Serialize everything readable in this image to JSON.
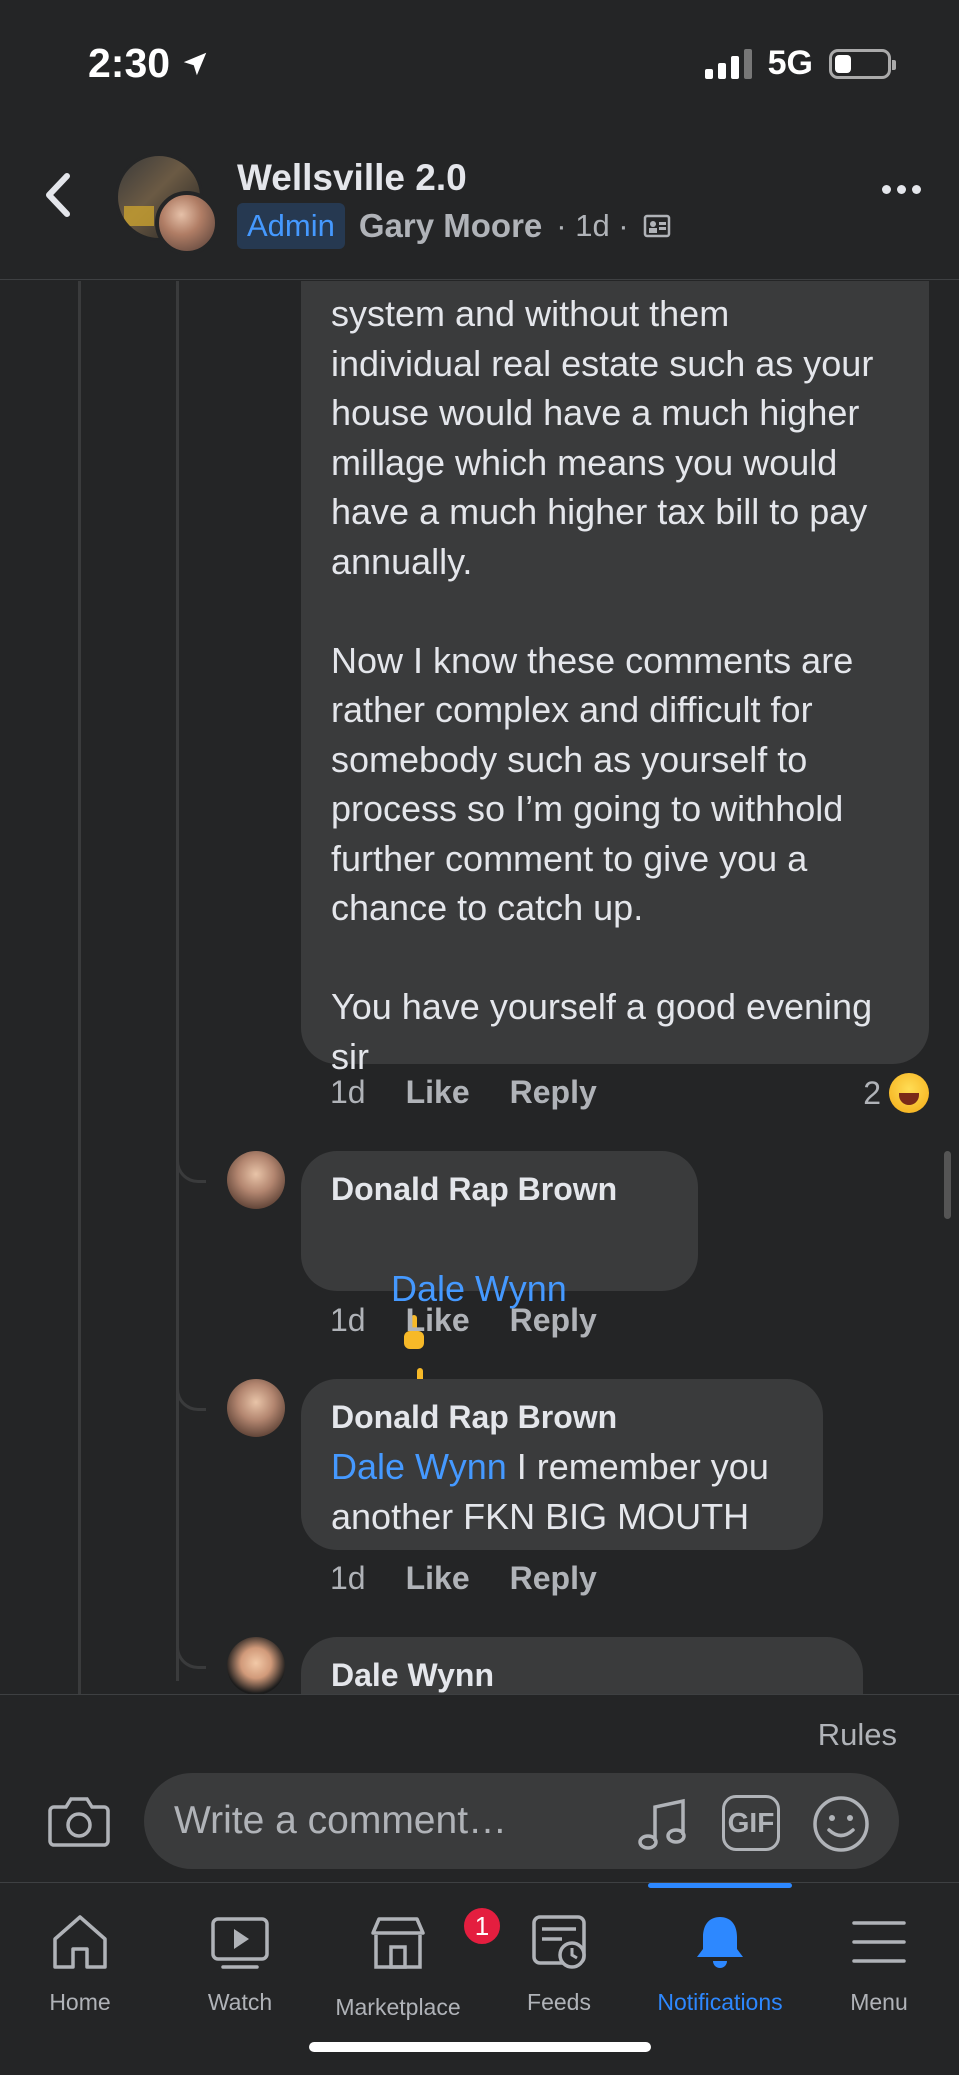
{
  "status_bar": {
    "time": "2:30",
    "network": "5G",
    "battery_level": 0.2
  },
  "header": {
    "group_title": "Wellsville 2.0",
    "badge": "Admin",
    "author": "Gary Moore",
    "timestamp": "· 1d ·",
    "icons": [
      "back-chevron-icon",
      "privacy-group-icon",
      "more-dots-icon"
    ]
  },
  "comments": [
    {
      "text": "system and without them\nindividual real estate such as your\nhouse would have a much higher\nmillage which means you would\nhave a much higher tax bill to pay\nannually.\n\nNow I know these comments are\nrather complex and difficult for\nsomebody such as yourself to\nprocess so I’m going to withhold\nfurther comment to give you a\nchance to catch up.\n\nYou have yourself a good evening\nsir",
      "time": "1d",
      "like": "Like",
      "reply": "Reply",
      "reaction_count": "2"
    },
    {
      "author": "Donald Rap Brown",
      "mention": "Dale Wynn",
      "text": "",
      "time": "1d",
      "like": "Like",
      "reply": "Reply"
    },
    {
      "author": "Donald Rap Brown",
      "mention": "Dale Wynn",
      "text": " I remember you\nanother FKN BIG MOUTH",
      "time": "1d",
      "like": "Like",
      "reply": "Reply"
    },
    {
      "author": "Dale Wynn"
    }
  ],
  "composer": {
    "rules": "Rules",
    "placeholder": "Write a comment…",
    "gif_label": "GIF"
  },
  "tabs": [
    {
      "label": "Home",
      "icon": "home-icon"
    },
    {
      "label": "Watch",
      "icon": "watch-icon"
    },
    {
      "label": "Marketplace",
      "icon": "marketplace-icon",
      "badge": "1"
    },
    {
      "label": "Feeds",
      "icon": "feeds-icon"
    },
    {
      "label": "Notifications",
      "icon": "bell-icon",
      "active": true
    },
    {
      "label": "Menu",
      "icon": "menu-icon"
    }
  ],
  "colors": {
    "background": "#242526",
    "bubble": "#3a3b3c",
    "accent": "#2d88ff",
    "mention": "#4599ff",
    "badge": "#e41e3f"
  }
}
